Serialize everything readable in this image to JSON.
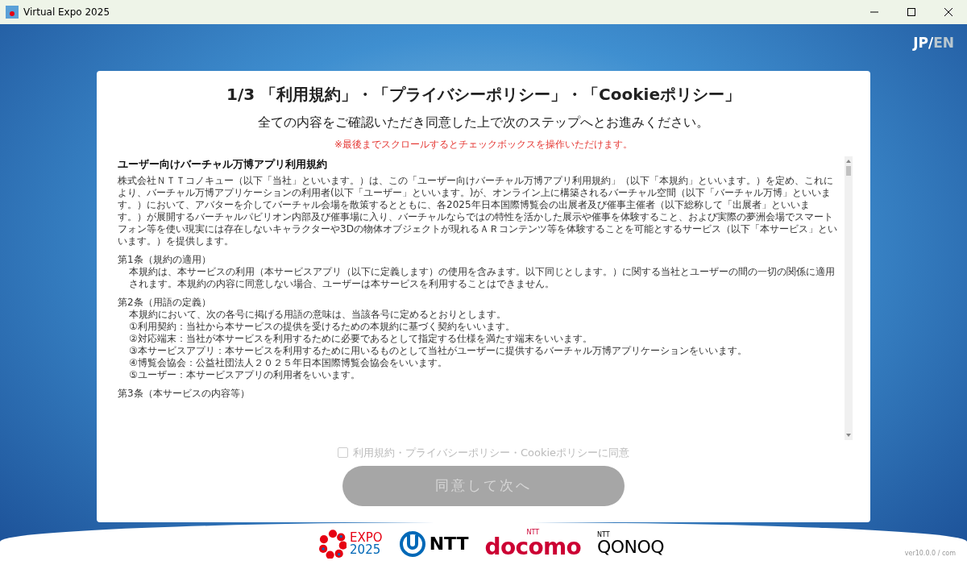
{
  "window": {
    "title": "Virtual Expo 2025"
  },
  "language": {
    "separator": "/",
    "options": [
      {
        "label": "JP",
        "selected": true
      },
      {
        "label": "EN",
        "selected": false
      }
    ]
  },
  "dialog": {
    "title": "1/3 「利用規約」・「プライバシーポリシー」・「Cookieポリシー」",
    "subtitle": "全ての内容をご確認いただき同意した上で次のステップへとお進みください。",
    "notice": "※最後までスクロールするとチェックボックスを操作いただけます。",
    "terms": {
      "heading": "ユーザー向けバーチャル万博アプリ利用規約",
      "blocks": [
        {
          "kind": "paragraph",
          "text": "株式会社ＮＴＴコノキュー（以下「当社」といいます。）は、この「ユーザー向けバーチャル万博アプリ利用規約」（以下「本規約」といいます。）を定め、これにより、バーチャル万博アプリケーションの利用者(以下「ユーザー」といいます。)が、オンライン上に構築されるバーチャル空間（以下「バーチャル万博」といいます。）において、アバターを介してバーチャル会場を散策するとともに、各2025年日本国際博覧会の出展者及び催事主催者（以下総称して「出展者」といいます。）が展開するバーチャルパビリオン内部及び催事場に入り、バーチャルならではの特性を活かした展示や催事を体験すること、および実際の夢洲会場でスマートフォン等を使い現実には存在しないキャラクターや3Dの物体オブジェクトが現れるＡＲコンテンツ等を体験することを可能とするサービス（以下「本サービス」といいます。）を提供します。"
        },
        {
          "kind": "article",
          "title": "第1条（規約の適用）",
          "body": "本規約は、本サービスの利用（本サービスアプリ（以下に定義します）の使用を含みます。以下同じとします。）に関する当社とユーザーの間の一切の関係に適用されます。本規約の内容に同意しない場合、ユーザーは本サービスを利用することはできません。"
        },
        {
          "kind": "article",
          "title": "第2条（用語の定義）",
          "body": "本規約において、次の各号に掲げる用語の意味は、当該各号に定めるとおりとします。",
          "items": [
            "①利用契約：当社から本サービスの提供を受けるための本規約に基づく契約をいいます。",
            "②対応端末：当社が本サービスを利用するために必要であるとして指定する仕様を満たす端末をいいます。",
            "③本サービスアプリ：本サービスを利用するために用いるものとして当社がユーザーに提供するバーチャル万博アプリケーションをいいます。",
            "④博覧会協会：公益社団法人２０２５年日本国際博覧会協会をいいます。",
            "⑤ユーザー：本サービスアプリの利用者をいいます。"
          ]
        },
        {
          "kind": "heading",
          "text": "第3条（本サービスの内容等）"
        }
      ]
    },
    "consent": {
      "label": "利用規約・プライバシーポリシー・Cookieポリシーに同意",
      "checked": false,
      "disabled": true
    },
    "next_button": {
      "label": "同意して次へ",
      "disabled": true
    }
  },
  "sponsors": [
    {
      "kind": "expo",
      "small": "EXPO",
      "text": "2025"
    },
    {
      "kind": "ntt",
      "text": "NTT"
    },
    {
      "kind": "docomo",
      "small": "NTT",
      "text": "docomo"
    },
    {
      "kind": "qonoq",
      "small": "NTT",
      "text": "QONOQ"
    }
  ],
  "version": "ver10.0.0 / com"
}
